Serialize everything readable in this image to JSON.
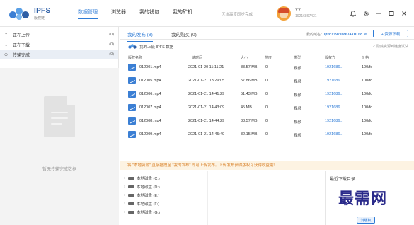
{
  "app": {
    "logo_title": "IPFS",
    "logo_subtitle": "版权链"
  },
  "nav": [
    {
      "label": "数据管理"
    },
    {
      "label": "浏览器"
    },
    {
      "label": "我的钱包"
    },
    {
      "label": "我的矿机"
    }
  ],
  "sync_status": "区块高度同步完成",
  "user": {
    "name": "YY",
    "id": "19216867431"
  },
  "sidebar": {
    "items": [
      {
        "label": "正在上传",
        "count": "(0)"
      },
      {
        "label": "正在下载",
        "count": "(0)"
      },
      {
        "label": "传输完成",
        "count": "(0)"
      }
    ],
    "empty_text": "暂无传输完成数据"
  },
  "tabs": [
    {
      "label": "我的发布 (8)"
    },
    {
      "label": "我的购买 (0)"
    }
  ],
  "domain": {
    "label": "我的域名：",
    "value": "ipfs://192168674310.ifc"
  },
  "upload_button": "+ 资源下载",
  "section": {
    "title": "我的上链 IPFS 数据",
    "right": "✓ 隐藏资源到链度试试"
  },
  "table": {
    "headers": [
      "版权名称",
      "上链时间",
      "大小",
      "热度",
      "类型",
      "版权方",
      "价格"
    ],
    "rows": [
      {
        "name": "012001.mp4",
        "time": "2021-01-20 11:11:21",
        "size": "83.57 MB",
        "heat": "0",
        "type": "视频",
        "owner": "1921686...",
        "price": "100/fc"
      },
      {
        "name": "012005.mp4",
        "time": "2021-01-21 13:29:05",
        "size": "57.86 MB",
        "heat": "0",
        "type": "视频",
        "owner": "1921686...",
        "price": "100/fc"
      },
      {
        "name": "012006.mp4",
        "time": "2021-01-21 14:41:29",
        "size": "51.43 MB",
        "heat": "0",
        "type": "视频",
        "owner": "1921686...",
        "price": "100/fc"
      },
      {
        "name": "012007.mp4",
        "time": "2021-01-21 14:43:09",
        "size": "45 MB",
        "heat": "0",
        "type": "视频",
        "owner": "1921686...",
        "price": "100/fc"
      },
      {
        "name": "012008.mp4",
        "time": "2021-01-21 14:44:29",
        "size": "38.57 MB",
        "heat": "0",
        "type": "视频",
        "owner": "1921686...",
        "price": "100/fc"
      },
      {
        "name": "012009.mp4",
        "time": "2021-01-21 14:45:49",
        "size": "32.15 MB",
        "heat": "0",
        "type": "视频",
        "owner": "1921686...",
        "price": "100/fc"
      }
    ]
  },
  "notice": "将 \"本地资源\" 直接拖拽至 \"我的发布\" 即可上传发布。上传发布获得版权可获得收益哦!",
  "drives": [
    {
      "label": "本地磁盘 (C:)"
    },
    {
      "label": "本地磁盘 (D:)"
    },
    {
      "label": "本地磁盘 (E:)"
    },
    {
      "label": "本地磁盘 (F:)"
    },
    {
      "label": "本地磁盘 (G:)"
    }
  ],
  "download_panel": {
    "title": "最近下载目录",
    "button": "浏版权"
  },
  "watermark": "最需网",
  "colors": {
    "accent": "#2e7bd6",
    "notice_bg": "#fdf3e2",
    "notice_text": "#d9822b"
  }
}
